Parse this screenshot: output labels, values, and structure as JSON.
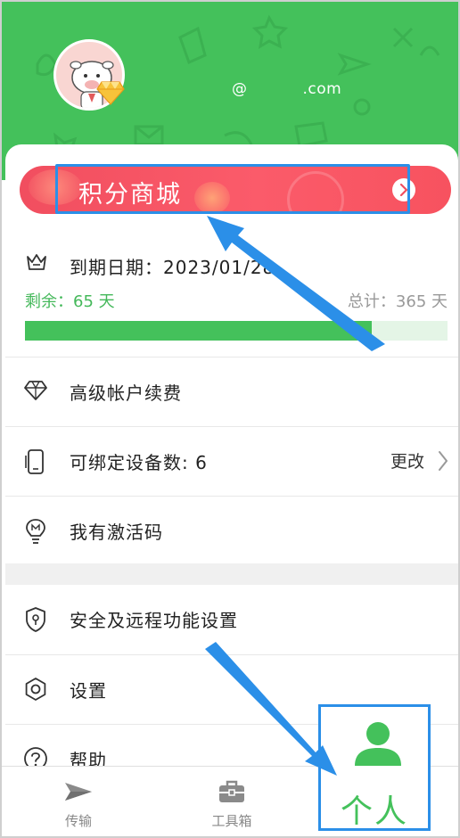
{
  "profile": {
    "email_at": "@",
    "email_domain": ".com",
    "avatar_icon": "avatar-cow-icon",
    "vip_icon": "diamond-badge-icon"
  },
  "points_mall": {
    "title": "积分商城",
    "arrow_icon": "chevron-right-circle-icon"
  },
  "membership": {
    "expiry_label": "到期日期：2023/01/28",
    "remaining_text": "剩余：65 天",
    "total_text": "总计：365 天",
    "progress_fraction": 0.82
  },
  "menu": {
    "renew": "高级帐户续费",
    "devices": "可绑定设备数: 6",
    "devices_action": "更改",
    "activation": "我有激活码",
    "security": "安全及远程功能设置",
    "settings": "设置",
    "help": "帮助"
  },
  "nav": {
    "transfer": "传输",
    "toolbox": "工具箱",
    "me": "个人"
  },
  "colors": {
    "brand_green": "#44c15b",
    "banner_red": "#f14e5f",
    "annotation_blue": "#2b8fe8"
  }
}
